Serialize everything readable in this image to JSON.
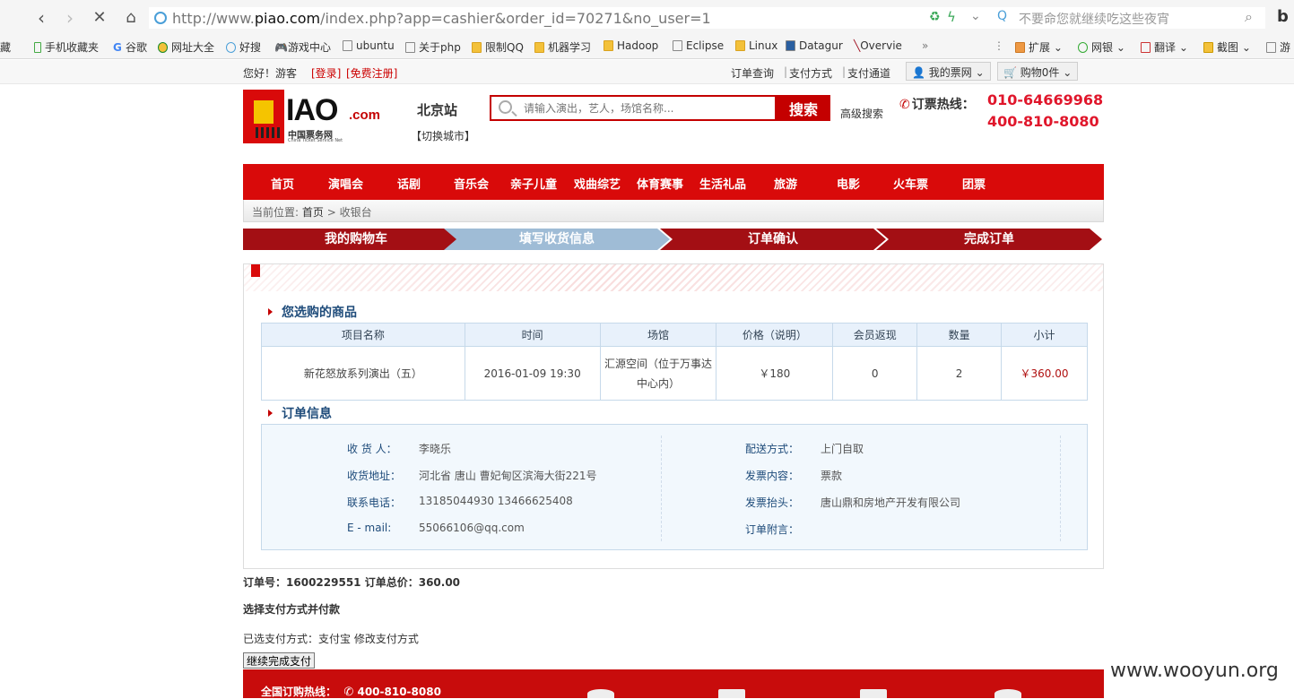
{
  "browser": {
    "url_prefix": "http://www.",
    "url_domain": "piao.com",
    "url_path": "/index.php?app=cashier&order_id=70271&no_user=1",
    "search_hint": "不要命您就继续吃这些夜宵",
    "bookmarks": [
      "藏",
      "手机收藏夹",
      "谷歌",
      "网址大全",
      "好搜",
      "游戏中心",
      "ubuntu",
      "关于php",
      "限制QQ",
      "机器学习",
      "Hadoop",
      "Eclipse",
      "Linux",
      "Datagur",
      "Overvie",
      "»"
    ],
    "right_tools": [
      "扩展",
      "网银",
      "翻译",
      "截图",
      "游"
    ]
  },
  "topstrip": {
    "greeting": "您好！游客",
    "login": "[登录]",
    "register": "[免费注册]",
    "links": [
      "订单查询",
      "支付方式",
      "支付通道"
    ],
    "my_account": "我的票网",
    "cart": "购物0件"
  },
  "header": {
    "logo_text": "IAO",
    "logo_dotcom": ".com",
    "logo_cn": "中国票务网",
    "logo_en": "China Ticket Service Net",
    "city": "北京站",
    "switch_city": "【切换城市】",
    "search_placeholder": "请输入演出，艺人，场馆名称...",
    "search_button": "搜索",
    "advanced_search": "高级搜索",
    "hotline_label": "订票热线：",
    "hotline_1": "010-64669968",
    "hotline_2": "400-810-8080"
  },
  "nav": [
    "首页",
    "演唱会",
    "话剧",
    "音乐会",
    "亲子儿童",
    "戏曲综艺",
    "体育赛事",
    "生活礼品",
    "旅游",
    "电影",
    "火车票",
    "团票"
  ],
  "breadcrumb": {
    "prefix": "当前位置:",
    "home": "首页",
    "sep": ">",
    "current": "收银台"
  },
  "steps": [
    "我的购物车",
    "填写收货信息",
    "订单确认",
    "完成订单"
  ],
  "colors": {
    "brand_red": "#d90a0a",
    "step_active": "#9fbcd6",
    "step_inactive": "#a30f14"
  },
  "products": {
    "title": "您选购的商品",
    "headers": [
      "项目名称",
      "时间",
      "场馆",
      "价格（说明）",
      "会员返现",
      "数量",
      "小计"
    ],
    "rows": [
      [
        "新花怒放系列演出（五）",
        "2016-01-09 19:30",
        "汇源空间（位于万事达中心内）",
        "￥180",
        "0",
        "2",
        "￥360.00"
      ]
    ]
  },
  "order_info": {
    "title": "订单信息",
    "left": [
      {
        "label": "收 货 人：",
        "value": "李晓乐"
      },
      {
        "label": "收货地址：",
        "value": "河北省 唐山 曹妃甸区滨海大街221号"
      },
      {
        "label": "联系电话：",
        "value": "13185044930 13466625408"
      },
      {
        "label": "E - mail:",
        "value": "55066106@qq.com"
      }
    ],
    "right": [
      {
        "label": "配送方式：",
        "value": "上门自取"
      },
      {
        "label": "发票内容：",
        "value": "票款"
      },
      {
        "label": "发票抬头：",
        "value": "唐山鼎和房地产开发有限公司"
      },
      {
        "label": "订单附言：",
        "value": ""
      }
    ]
  },
  "summary": {
    "order_no_label": "订单号：",
    "order_no": "1600229551",
    "total_label": "订单总价：",
    "total": "360.00",
    "choose_pay": "选择支付方式并付款",
    "selected_pay": "已选支付方式：支付宝 修改支付方式",
    "continue_button": "继续完成支付"
  },
  "footer": {
    "hotline_label": "全国订购热线：",
    "hotline": "400-810-8080"
  },
  "watermark": "www.wooyun.org"
}
